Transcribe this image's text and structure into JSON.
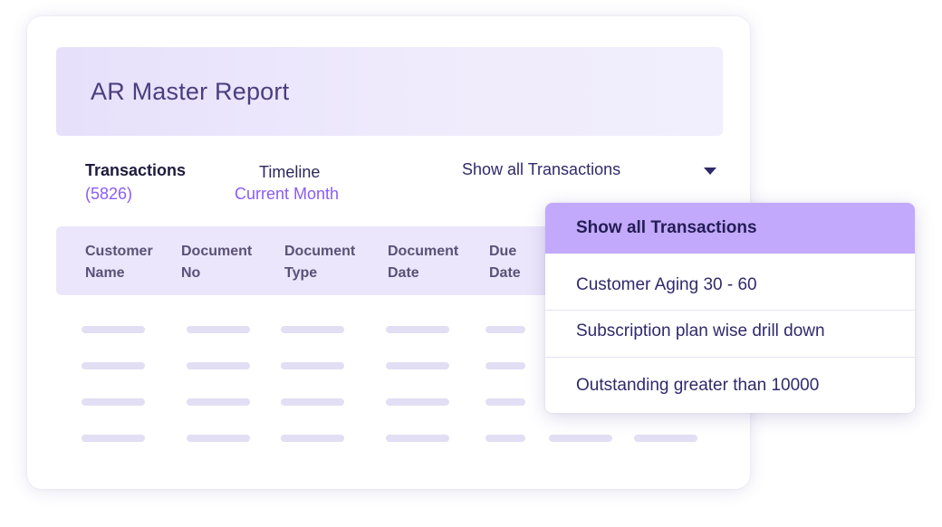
{
  "report": {
    "title": "AR Master Report"
  },
  "summary": {
    "transactions_label": "Transactions",
    "transactions_count": "(5826)",
    "timeline_label": "Timeline",
    "timeline_value": "Current Month"
  },
  "filter": {
    "selected": "Show all Transactions",
    "options": [
      "Show all Transactions",
      "Customer Aging 30 - 60",
      "Subscription plan wise drill down",
      "Outstanding greater than 10000"
    ]
  },
  "table": {
    "columns": [
      "Customer\nName",
      "Document\nNo",
      "Document\nType",
      "Document\nDate",
      "Due\nDate"
    ],
    "placeholder_rows": 4
  },
  "colors": {
    "accent": "#8a5cf6",
    "selected_option_bg": "#c3a9fb",
    "header_bg": "#ebe6fb",
    "text_dark": "#2f2a6b"
  },
  "icons": {
    "filter_caret": "caret-down-icon"
  }
}
